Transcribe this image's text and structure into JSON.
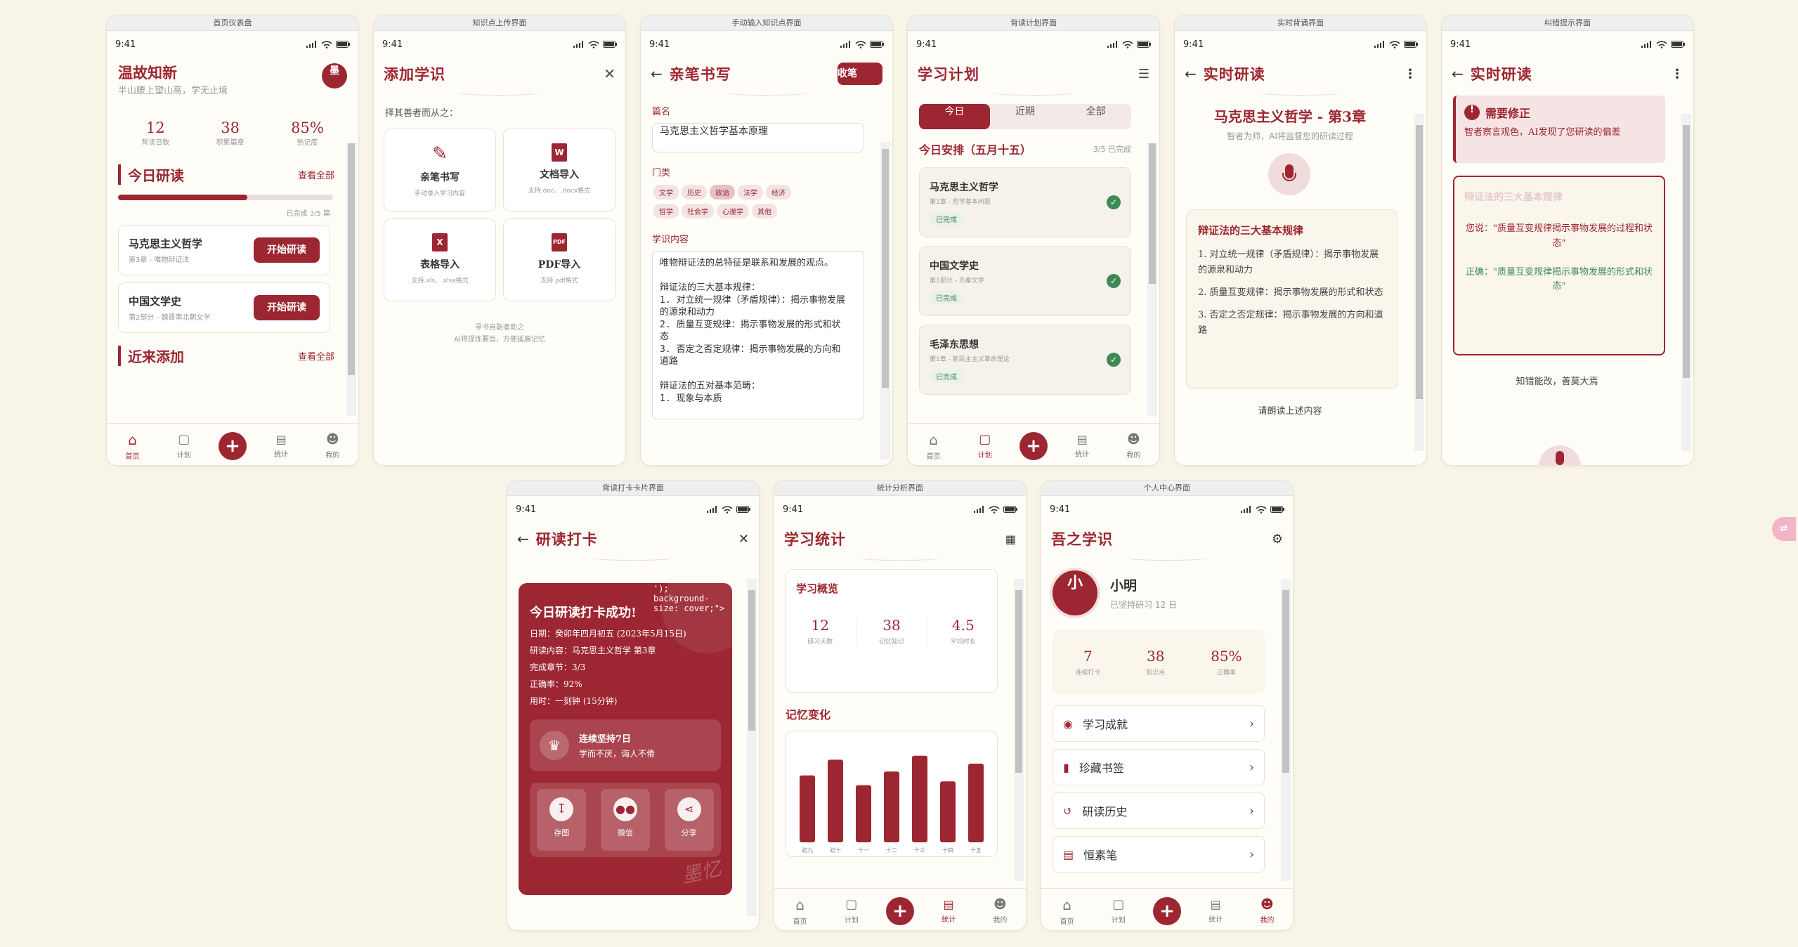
{
  "colors": {
    "accent": "#9c2631",
    "background": "#f8f4e7",
    "success": "#3e8a55"
  },
  "status": {
    "time": "9:41"
  },
  "nav": {
    "home": "首页",
    "plan": "计划",
    "stats": "统计",
    "me": "我的",
    "plus": "+"
  },
  "screens": {
    "dashboard": {
      "caption": "首页仪表盘",
      "title": "温故知新",
      "subtitle": "半山腰上望山高，学无止境",
      "avatar": "墨",
      "stats": [
        {
          "value": "12",
          "label": "背读日数"
        },
        {
          "value": "38",
          "label": "积累篇章"
        },
        {
          "value": "85%",
          "label": "熟记度"
        }
      ],
      "today_title": "今日研读",
      "see_all": "查看全部",
      "progress_fraction": 0.6,
      "progress_text": "已完成 3/5 篇",
      "items": [
        {
          "title": "马克思主义哲学",
          "sub": "第3章 - 唯物辩证法",
          "action": "开始研读"
        },
        {
          "title": "中国文学史",
          "sub": "第2部分 - 魏晋南北朝文学",
          "action": "开始研读"
        }
      ],
      "recent_title": "近来添加",
      "recent_more": "查看全部"
    },
    "upload": {
      "caption": "知识点上传界面",
      "title": "添加学识",
      "prompt": "择其善者而从之：",
      "options": [
        {
          "title": "亲笔书写",
          "sub": "手动录入学习内容",
          "icon": "pen-icon"
        },
        {
          "title": "文档导入",
          "sub": "支持.doc、.docx格式",
          "icon": "word-icon"
        },
        {
          "title": "表格导入",
          "sub": "支持.xls、.xlsx格式",
          "icon": "excel-icon"
        },
        {
          "title": "PDF导入",
          "sub": "支持.pdf格式",
          "icon": "pdf-icon"
        }
      ],
      "footer1": "寻书自能者助之",
      "footer2": "AI将提炼要旨，方便延展记忆"
    },
    "manual": {
      "caption": "手动输入知识点界面",
      "title": "亲笔书写",
      "save": "收笔",
      "name_label": "篇名",
      "name_value": "马克思主义哲学基本原理",
      "category_label": "门类",
      "categories": [
        "文学",
        "历史",
        "政治",
        "法学",
        "经济",
        "哲学",
        "社会学",
        "心理学",
        "其他"
      ],
      "content_label": "学识内容",
      "content": "唯物辩证法的总特征是联系和发展的观点。\n\n辩证法的三大基本规律：\n1. 对立统一规律（矛盾规律）：揭示事物发展的源泉和动力\n2. 质量互变规律：揭示事物发展的形式和状态\n3. 否定之否定规律：揭示事物发展的方向和道路\n\n辩证法的五对基本范畴：\n1. 现象与本质"
    },
    "plan": {
      "caption": "背读计划界面",
      "title": "学习计划",
      "tabs": [
        "今日",
        "近期",
        "全部"
      ],
      "today_heading": "今日安排（五月十五）",
      "today_count": "3/5 已完成",
      "items": [
        {
          "title": "马克思主义哲学",
          "sub": "第1章 - 哲学基本问题",
          "tag": "已完成"
        },
        {
          "title": "中国文学史",
          "sub": "第1部分 - 先秦文学",
          "tag": "已完成"
        },
        {
          "title": "毛泽东思想",
          "sub": "第1章 - 新民主主义革命理论",
          "tag": "已完成"
        }
      ]
    },
    "reading": {
      "caption": "实时背诵界面",
      "title": "实时研读",
      "chapter": "马克思主义哲学 - 第3章",
      "hint": "智者为师，AI将监督您的研读过程",
      "card_title": "辩证法的三大基本规律",
      "points": [
        "1. 对立统一规律（矛盾规律）：揭示事物发展的源泉和动力",
        "2. 质量互变规律：揭示事物发展的形式和状态",
        "3. 否定之否定规律：揭示事物发展的方向和道路"
      ],
      "footer": "请朗读上述内容"
    },
    "correction": {
      "caption": "纠错提示界面",
      "title": "实时研读",
      "alert_title": "需要修正",
      "alert_body": "智者察言观色，AI发现了您研读的偏差",
      "faded_title": "辩证法的三大基本规律",
      "you_said": "您说：\"质量互变规律揭示事物发展的过程和状态\"",
      "correct": "正确：\"质量互变规律揭示事物发展的形式和状态\"",
      "footer": "知错能改，善莫大焉"
    },
    "checkin": {
      "caption": "背读打卡卡片界面",
      "title": "研读打卡",
      "card_title": "今日研读打卡成功!",
      "overlay_code": "'); background-size: cover;\">",
      "lines": [
        "日期：癸卯年四月初五 (2023年5月15日)",
        "研读内容：马克思主义哲学 第3章",
        "完成章节：3/3",
        "正确率：92%",
        "用时：一刻钟 (15分钟)"
      ],
      "streak_title": "连续坚持7日",
      "streak_sub": "学而不厌，诲人不倦",
      "actions": [
        "存图",
        "微信",
        "分享"
      ],
      "watermark": "墨忆"
    },
    "stats": {
      "caption": "统计分析界面",
      "title": "学习统计",
      "overview_title": "学习概览",
      "overview": [
        {
          "value": "12",
          "label": "研习天数"
        },
        {
          "value": "38",
          "label": "记忆知识"
        },
        {
          "value": "4.5",
          "label": "平均时长"
        }
      ],
      "chart_title": "记忆变化"
    },
    "profile": {
      "caption": "个人中心界面",
      "title": "吾之学识",
      "avatar": "小",
      "name": "小明",
      "days": "已坚持研习 12 日",
      "stats": [
        {
          "value": "7",
          "label": "连续打卡"
        },
        {
          "value": "38",
          "label": "知识点"
        },
        {
          "value": "85%",
          "label": "正确率"
        }
      ],
      "menu": [
        "学习成就",
        "珍藏书签",
        "研读历史",
        "恒素笔"
      ]
    }
  },
  "chart_data": {
    "type": "bar",
    "categories": [
      "初九",
      "初十",
      "十一",
      "十二",
      "十三",
      "十四",
      "十五"
    ],
    "values": [
      68,
      84,
      58,
      72,
      88,
      62,
      80
    ],
    "ylim": [
      0,
      100
    ]
  }
}
